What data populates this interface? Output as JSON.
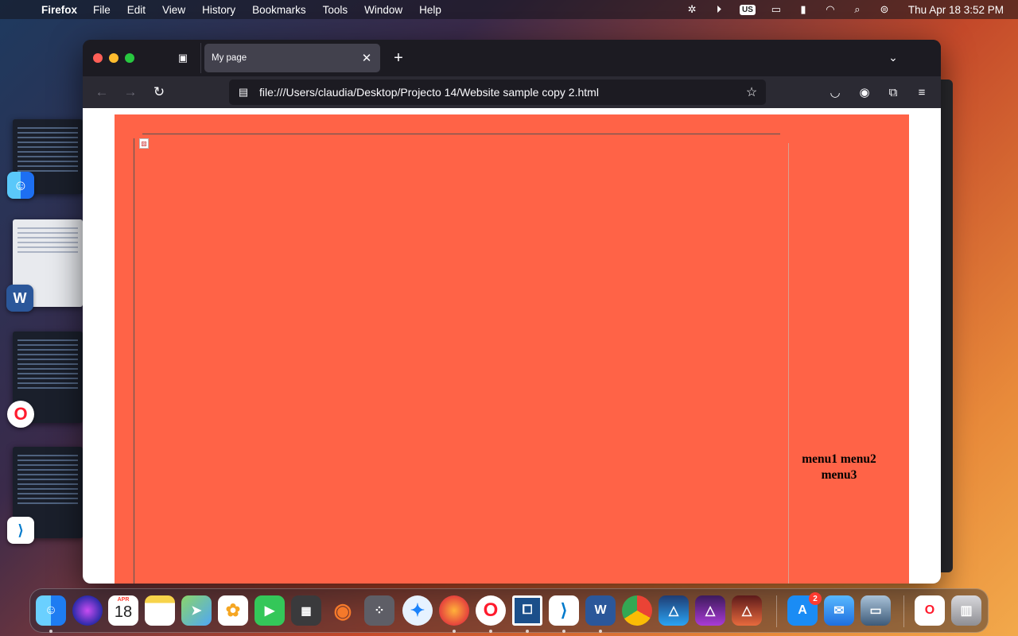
{
  "menubar": {
    "app_name": "Firefox",
    "items": [
      "File",
      "Edit",
      "View",
      "History",
      "Bookmarks",
      "Tools",
      "Window",
      "Help"
    ],
    "input_source": "US",
    "clock": "Thu Apr 18  3:52 PM"
  },
  "browser": {
    "tab_title": "My page",
    "url": "file:///Users/claudia/Desktop/Projecto 14/Website sample copy 2.html"
  },
  "page": {
    "menu_text": "menu1 menu2 menu3",
    "background_color": "#ff6347"
  },
  "dock": {
    "calendar_month": "APR",
    "calendar_day": "18",
    "app_store_badge": "2"
  }
}
